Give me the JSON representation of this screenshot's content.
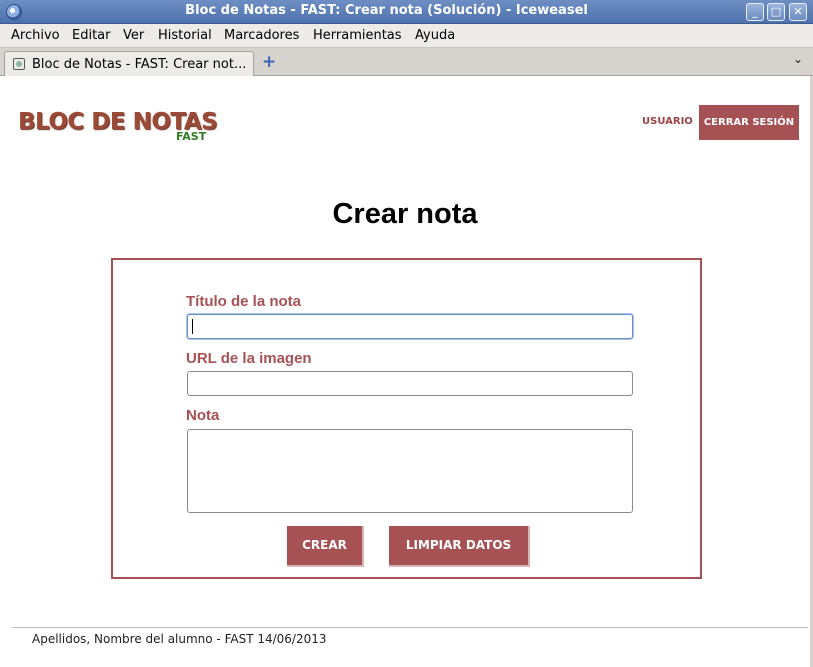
{
  "window": {
    "title": "Bloc de Notas - FAST: Crear nota (Solución) - Iceweasel",
    "controls": {
      "minimize": "_",
      "maximize": "□",
      "close": "✕"
    }
  },
  "menubar": {
    "items": [
      "Archivo",
      "Editar",
      "Ver",
      "Historial",
      "Marcadores",
      "Herramientas",
      "Ayuda"
    ]
  },
  "tabs": {
    "active_label": "Bloc de Notas - FAST: Crear not...",
    "new_tab": "+",
    "list": "⌄"
  },
  "header": {
    "logo_main": "BLOC DE NOTAS",
    "logo_sub": "FAST",
    "user_link": "USUARIO",
    "logout_button": "CERRAR SESIÓN"
  },
  "main": {
    "title": "Crear nota",
    "form": {
      "title_label": "Título de la nota",
      "title_value": "",
      "image_label": "URL de la imagen",
      "image_value": "",
      "note_label": "Nota",
      "note_value": "",
      "create_button": "CREAR",
      "clear_button": "LIMPIAR DATOS"
    }
  },
  "footer": {
    "text": "Apellidos, Nombre del alumno - FAST 14/06/2013"
  },
  "colors": {
    "accent": "#a65255",
    "logo": "#9a4a36",
    "logo_sub": "#2f7d20",
    "titlebar": "#5b7fb8"
  },
  "icons": [
    "browser-app-icon",
    "page-favicon-icon",
    "new-tab-icon",
    "tab-list-icon"
  ]
}
